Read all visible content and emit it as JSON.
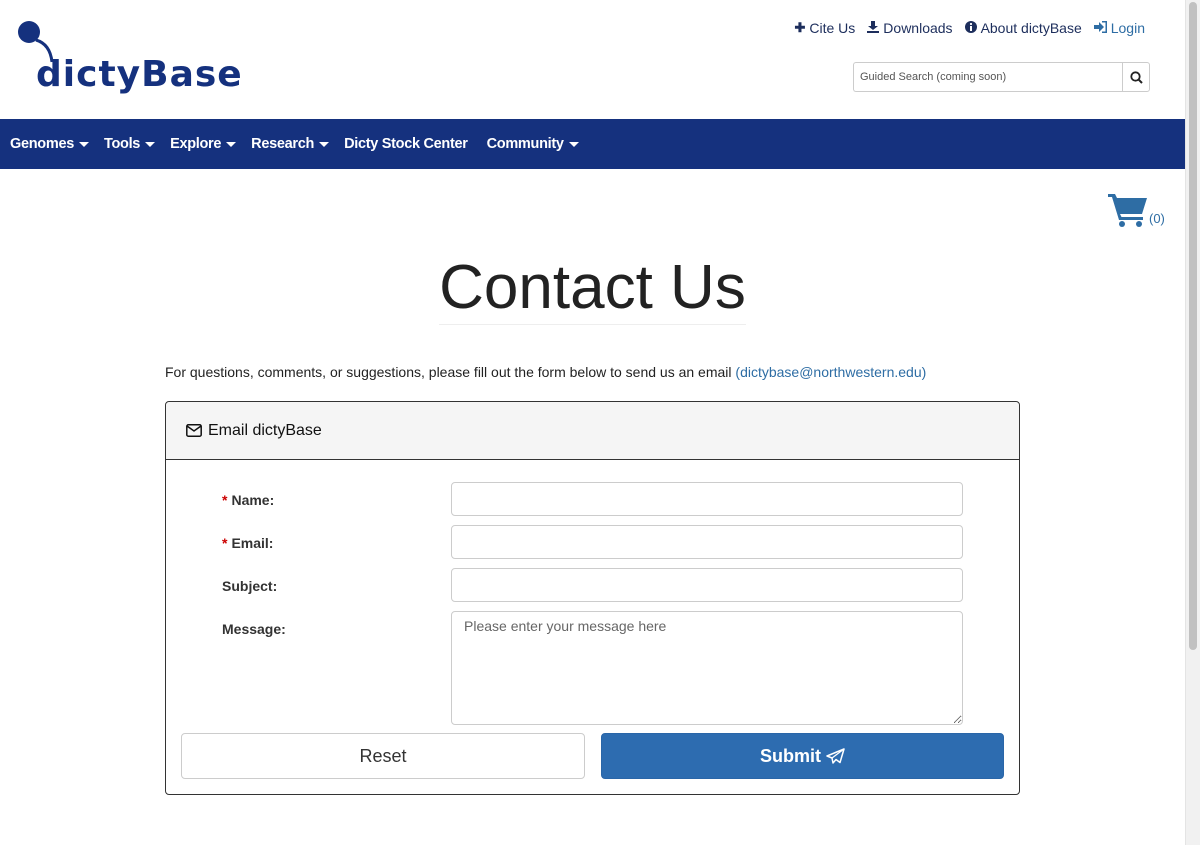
{
  "header": {
    "logo_text": "dictyBase",
    "top_links": [
      {
        "label": "Cite Us",
        "icon": "plus-icon"
      },
      {
        "label": "Downloads",
        "icon": "download-icon"
      },
      {
        "label": "About dictyBase",
        "icon": "info-icon"
      },
      {
        "label": "Login",
        "icon": "sign-in-icon"
      }
    ],
    "search_placeholder": "Guided Search (coming soon)"
  },
  "navbar": {
    "items": [
      {
        "label": "Genomes",
        "dropdown": true
      },
      {
        "label": "Tools",
        "dropdown": true
      },
      {
        "label": "Explore",
        "dropdown": true
      },
      {
        "label": "Research",
        "dropdown": true
      },
      {
        "label": "Dicty Stock Center",
        "dropdown": false
      },
      {
        "label": "Community",
        "dropdown": true
      }
    ]
  },
  "cart": {
    "count": "(0)"
  },
  "page": {
    "title": "Contact Us",
    "intro_text": "For questions, comments, or suggestions, please fill out the form below to send us an email ",
    "intro_email": "(dictybase@northwestern.edu)"
  },
  "form": {
    "panel_title": "Email dictyBase",
    "required_marker": "*",
    "name_label": "Name:",
    "email_label": "Email:",
    "subject_label": "Subject:",
    "message_label": "Message:",
    "message_placeholder": "Please enter your message here",
    "reset_label": "Reset",
    "submit_label": "Submit"
  },
  "colors": {
    "brand_navy": "#15317e",
    "link_blue": "#2e6da4",
    "submit_blue": "#2d6cb0"
  }
}
